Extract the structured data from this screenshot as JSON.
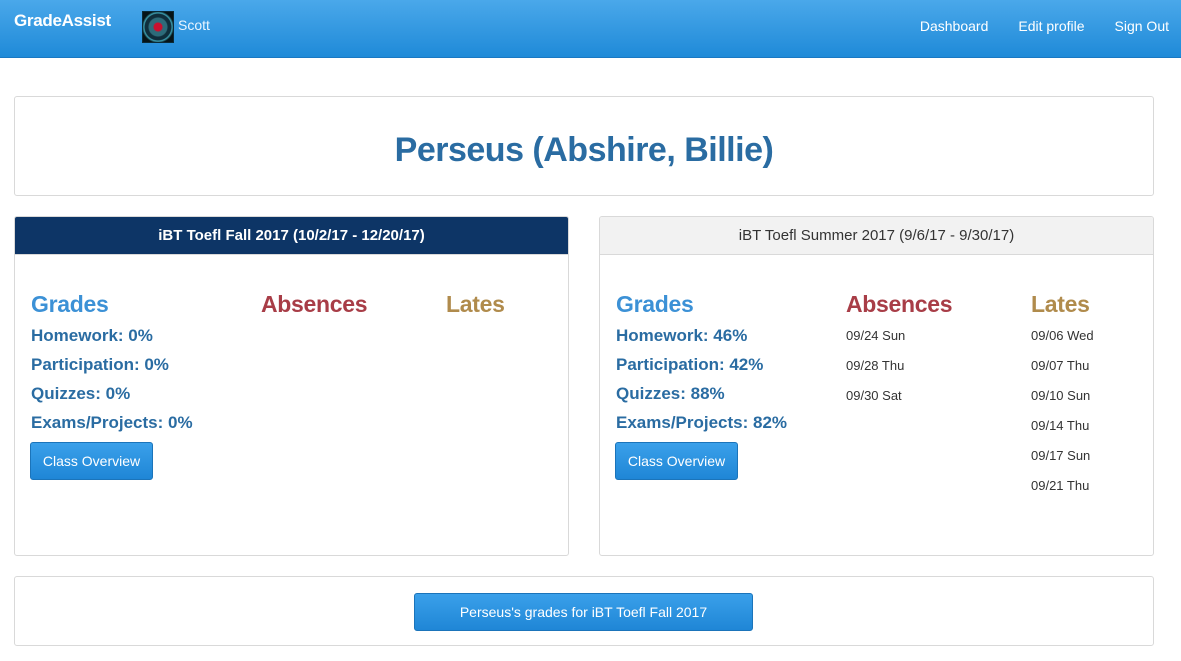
{
  "navbar": {
    "brand": "GradeAssist",
    "username": "Scott",
    "links": [
      "Dashboard",
      "Edit profile",
      "Sign Out"
    ]
  },
  "page_title": "Perseus (Abshire, Billie)",
  "columns": {
    "grades": "Grades",
    "absences": "Absences",
    "lates": "Lates"
  },
  "courses": [
    {
      "header": "iBT Toefl Fall 2017 (10/2/17 - 12/20/17)",
      "grades": [
        "Homework: 0%",
        "Participation: 0%",
        "Quizzes: 0%",
        "Exams/Projects: 0%"
      ],
      "absences": [],
      "lates": [],
      "button": "Class Overview"
    },
    {
      "header": "iBT Toefl Summer 2017 (9/6/17 - 9/30/17)",
      "grades": [
        "Homework: 46%",
        "Participation: 42%",
        "Quizzes: 88%",
        "Exams/Projects: 82%"
      ],
      "absences": [
        "09/24 Sun",
        "09/28 Thu",
        "09/30 Sat"
      ],
      "lates": [
        "09/06 Wed",
        "09/07 Thu",
        "09/10 Sun",
        "09/14 Thu",
        "09/17 Sun",
        "09/21 Thu"
      ],
      "button": "Class Overview"
    }
  ],
  "bottom_button": "Perseus's grades for iBT Toefl Fall 2017",
  "colors": {
    "navbar": "#2a96e0",
    "active_header": "#0d3566",
    "grades": "#3c91d6",
    "absences": "#a83d47",
    "lates": "#b08b4c",
    "title": "#2a6ca2"
  }
}
